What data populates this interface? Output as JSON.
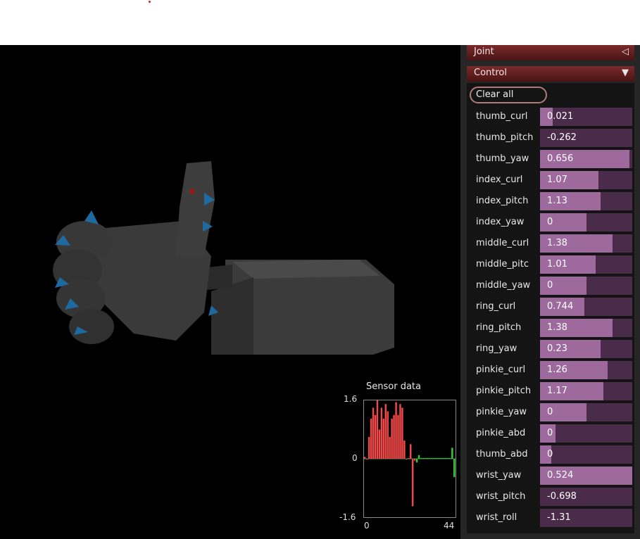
{
  "panel": {
    "joint_header": "Joint",
    "joint_arrow": "◁",
    "control_header": "Control",
    "control_arrow": "▼",
    "clear_label": "Clear all",
    "sliders": [
      {
        "name": "thumb_curl",
        "value": "0.021",
        "fill": 0.14
      },
      {
        "name": "thumb_pitch",
        "value": "-0.262",
        "fill": 0.0
      },
      {
        "name": "thumb_yaw",
        "value": "0.656",
        "fill": 0.97
      },
      {
        "name": "index_curl",
        "value": "1.07",
        "fill": 0.63
      },
      {
        "name": "index_pitch",
        "value": "1.13",
        "fill": 0.66
      },
      {
        "name": "index_yaw",
        "value": "0",
        "fill": 0.5
      },
      {
        "name": "middle_curl",
        "value": "1.38",
        "fill": 0.79
      },
      {
        "name": "middle_pitc",
        "value": "1.01",
        "fill": 0.6
      },
      {
        "name": "middle_yaw",
        "value": "0",
        "fill": 0.5
      },
      {
        "name": "ring_curl",
        "value": "0.744",
        "fill": 0.48
      },
      {
        "name": "ring_pitch",
        "value": "1.38",
        "fill": 0.79
      },
      {
        "name": "ring_yaw",
        "value": "0.23",
        "fill": 0.66
      },
      {
        "name": "pinkie_curl",
        "value": "1.26",
        "fill": 0.73
      },
      {
        "name": "pinkie_pitch",
        "value": "1.17",
        "fill": 0.69
      },
      {
        "name": "pinkie_yaw",
        "value": "0",
        "fill": 0.5
      },
      {
        "name": "pinkie_abd",
        "value": "0",
        "fill": 0.17
      },
      {
        "name": "thumb_abd",
        "value": "0",
        "fill": 0.12
      },
      {
        "name": "wrist_yaw",
        "value": "0.524",
        "fill": 1.0
      },
      {
        "name": "wrist_pitch",
        "value": "-0.698",
        "fill": 0.0
      },
      {
        "name": "wrist_roll",
        "value": "-1.31",
        "fill": 0.0
      }
    ]
  },
  "colors": {
    "track": "#4a2c4a",
    "fill": "#9e6a9e",
    "header": "#6a2222",
    "sensor_positive": "#f04848",
    "sensor_tail": "#30d030"
  },
  "sensor": {
    "title": "Sensor data",
    "y_top": "1.6",
    "y_mid": "0",
    "y_bottom": "-1.6",
    "x_left": "0",
    "x_right": "44"
  },
  "chart_data": {
    "type": "bar",
    "title": "Sensor data",
    "ylim": [
      -1.6,
      1.6
    ],
    "xlim": [
      0,
      44
    ],
    "x_ticks": [
      "0",
      "44"
    ],
    "y_ticks": [
      "-1.6",
      "0",
      "1.6"
    ],
    "values": [
      0.05,
      0.0,
      0.6,
      1.1,
      1.4,
      1.2,
      1.6,
      0.8,
      1.4,
      1.1,
      1.5,
      1.3,
      0.6,
      1.1,
      1.2,
      1.55,
      1.2,
      1.5,
      1.4,
      0.5,
      0.0,
      0.02,
      0.4,
      -1.3,
      -0.05,
      -0.1,
      0.1,
      0.02,
      0.02,
      0.02,
      0.02,
      0.02,
      0.02,
      0.02,
      0.02,
      0.02,
      0.02,
      0.02,
      0.02,
      0.02,
      0.02,
      0.02,
      0.3,
      -0.5
    ],
    "colors_by_index": "red for first 25 samples, green after"
  }
}
